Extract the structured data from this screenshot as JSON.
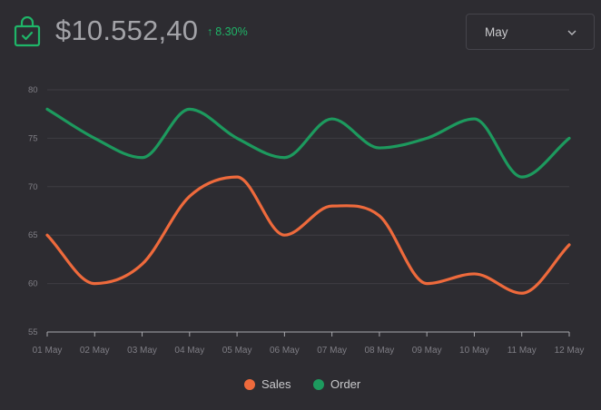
{
  "header": {
    "amount": "$10.552,40",
    "change": "8.30%",
    "change_arrow": "↑",
    "icon": "shopping-bag-check-icon",
    "month_select": {
      "selected": "May",
      "icon": "chevron-down-icon"
    }
  },
  "colors": {
    "background": "#2d2c31",
    "accent_green": "#1fb568",
    "sales": "#ee6a3c",
    "order": "#1d9a5e",
    "grid": "#3e3d43",
    "tick_text": "#7f7e85"
  },
  "chart_data": {
    "type": "line",
    "categories": [
      "01 May",
      "02 May",
      "03 May",
      "04 May",
      "05 May",
      "06 May",
      "07 May",
      "08 May",
      "09 May",
      "10 May",
      "11 May",
      "12 May"
    ],
    "series": [
      {
        "name": "Sales",
        "color": "#ee6a3c",
        "values": [
          65,
          60,
          62,
          69,
          71,
          65,
          68,
          67,
          60,
          61,
          59,
          64
        ]
      },
      {
        "name": "Order",
        "color": "#1d9a5e",
        "values": [
          78,
          75,
          73,
          78,
          75,
          73,
          77,
          74,
          75,
          77,
          71,
          75
        ]
      }
    ],
    "ylim": [
      55,
      80
    ],
    "yticks": [
      55,
      60,
      65,
      70,
      75,
      80
    ],
    "grid": true,
    "curve": "smooth",
    "legend_position": "bottom-center"
  }
}
